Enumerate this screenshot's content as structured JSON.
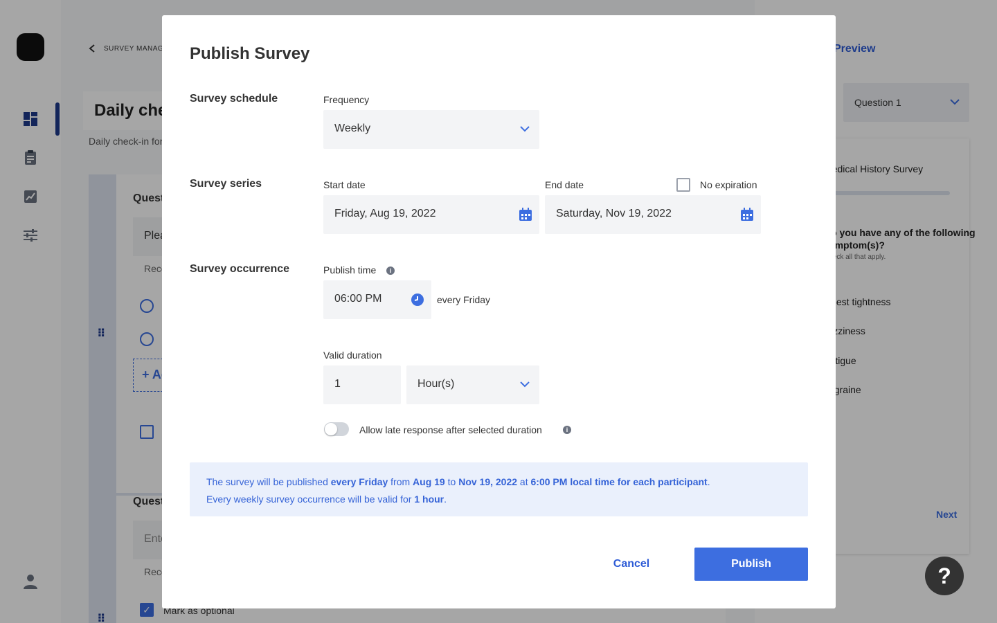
{
  "background": {
    "breadcrumb": "SURVEY MANAGEMENT",
    "survey_title": "Daily check-in",
    "survey_subtitle": "Daily check-in for participants",
    "question_label_1": "Question",
    "question_placeholder_1": "Please",
    "recommend_1": "Recommended",
    "add_option": "+ Add",
    "question_label_2": "Question",
    "question_placeholder_2": "Enter",
    "recommend_2": "Recommended",
    "mark_optional": "Mark as optional"
  },
  "preview": {
    "title": "Preview",
    "question_select": "Question 1",
    "survey_name": "Medical History Survey",
    "question_text_1": "Do you have any of the following",
    "question_text_2": "symptom(s)?",
    "question_hint": "Check all that apply.",
    "options": [
      "Chest tightness",
      "Dizziness",
      "Fatigue",
      "Migraine"
    ],
    "next_label": "Next"
  },
  "help_label": "?",
  "modal": {
    "title": "Publish Survey",
    "schedule": {
      "section_label": "Survey schedule",
      "frequency_label": "Frequency",
      "frequency_value": "Weekly"
    },
    "series": {
      "section_label": "Survey series",
      "start_label": "Start date",
      "start_value": "Friday, Aug 19, 2022",
      "end_label": "End date",
      "end_value": "Saturday, Nov 19, 2022",
      "no_expiration_label": "No expiration"
    },
    "occurrence": {
      "section_label": "Survey occurrence",
      "publish_time_label": "Publish time",
      "publish_time_value": "06:00 PM",
      "every_label": "every Friday",
      "valid_duration_label": "Valid duration",
      "duration_value": "1",
      "duration_unit": "Hour(s)",
      "late_response_label": "Allow late response after selected duration"
    },
    "summary": {
      "line1_a": "The survey will be published ",
      "line1_b": "every Friday",
      "line1_c": " from ",
      "line1_d": "Aug 19",
      "line1_e": " to ",
      "line1_f": "Nov 19, 2022",
      "line1_g": " at ",
      "line1_h": "6:00 PM local time for each participant",
      "line1_i": ".",
      "line2_a": "Every weekly survey occurrence will be valid for ",
      "line2_b": "1 hour",
      "line2_c": "."
    },
    "cancel_label": "Cancel",
    "publish_label": "Publish"
  },
  "colors": {
    "accent": "#3d6ee0",
    "summary_bg": "#eaf0fc",
    "field_bg": "#f3f4f6"
  }
}
